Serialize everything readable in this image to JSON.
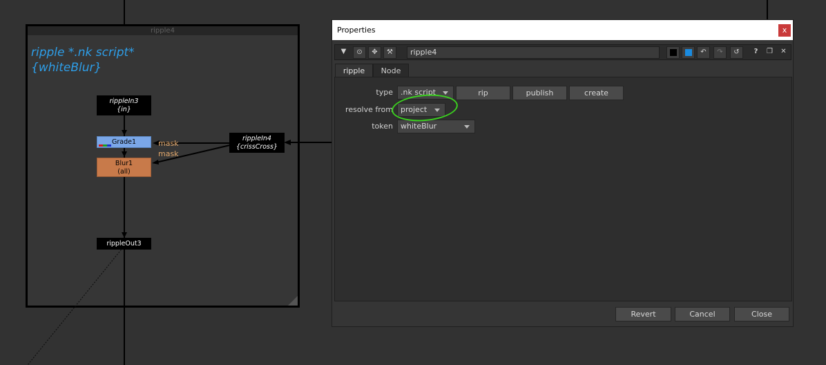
{
  "graph": {
    "backdrop": {
      "title": "ripple4",
      "label_line1": "ripple *.nk script*",
      "label_line2": "{whiteBlur}"
    },
    "nodes": {
      "ripple_in3": {
        "name": "rippleIn3",
        "sub": "{in}"
      },
      "grade1": {
        "name": "Grade1"
      },
      "blur1": {
        "name": "Blur1",
        "sub": "(all)"
      },
      "ripple_in4": {
        "name": "rippleIn4",
        "sub": "{crissCross}"
      },
      "ripple_out3": {
        "name": "rippleOut3"
      }
    },
    "mask_labels": [
      "mask",
      "mask"
    ],
    "colors": {
      "grade": "#7aa7e8",
      "blur": "#c87a4a",
      "label": "#2e9ee8"
    }
  },
  "properties": {
    "title": "Properties",
    "close_label": "x",
    "node_name": "ripple4",
    "tabs": [
      {
        "label": "ripple"
      },
      {
        "label": "Node"
      }
    ],
    "knobs": {
      "type": {
        "label": "type",
        "value": ".nk script",
        "buttons": [
          "rip",
          "publish",
          "create"
        ]
      },
      "resolve_from": {
        "label": "resolve from",
        "value": "project"
      },
      "token": {
        "label": "token",
        "value": "whiteBlur"
      }
    },
    "footer": {
      "revert": "Revert",
      "cancel": "Cancel",
      "close": "Close"
    },
    "toolbar_icons": [
      "collapse-icon",
      "viewer-icon",
      "center-icon",
      "wrench-icon",
      "black-swatch-icon",
      "blue-swatch-icon",
      "undo-icon",
      "redo-icon",
      "revert-icon",
      "help-icon",
      "float-icon",
      "close-icon"
    ],
    "colors": {
      "highlight": "#3bd11f",
      "close_button": "#c93a3a"
    }
  }
}
